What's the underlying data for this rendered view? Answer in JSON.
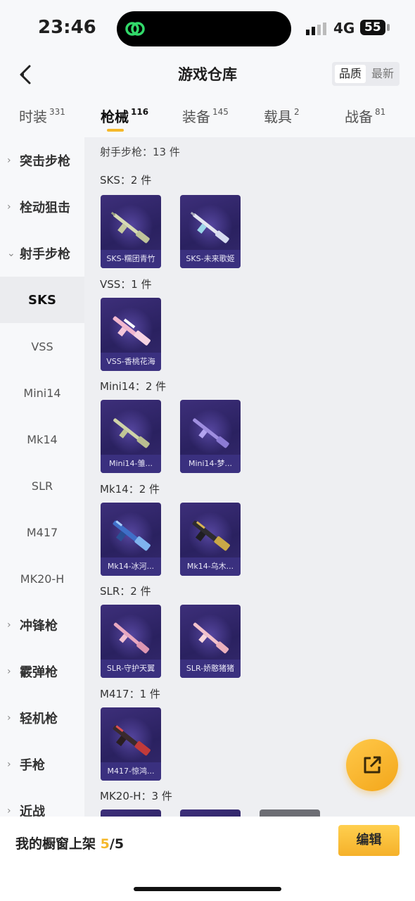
{
  "status": {
    "time": "23:46",
    "network": "4G",
    "battery": "55"
  },
  "header": {
    "title": "游戏仓库",
    "sort_quality": "品质",
    "sort_latest": "最新"
  },
  "tabs": [
    {
      "label": "时装",
      "count": "331"
    },
    {
      "label": "枪械",
      "count": "116"
    },
    {
      "label": "装备",
      "count": "145"
    },
    {
      "label": "载具",
      "count": "2"
    },
    {
      "label": "战备",
      "count": "81"
    }
  ],
  "sidebar": {
    "items": [
      {
        "label": "突击步枪"
      },
      {
        "label": "栓动狙击"
      },
      {
        "label": "射手步枪"
      },
      {
        "label": "SKS"
      },
      {
        "label": "VSS"
      },
      {
        "label": "Mini14"
      },
      {
        "label": "Mk14"
      },
      {
        "label": "SLR"
      },
      {
        "label": "M417"
      },
      {
        "label": "MK20-H"
      },
      {
        "label": "冲锋枪"
      },
      {
        "label": "霰弹枪"
      },
      {
        "label": "轻机枪"
      },
      {
        "label": "手枪"
      },
      {
        "label": "近战"
      }
    ]
  },
  "main": {
    "header": "射手步枪：13 件",
    "groups": [
      {
        "title": "SKS：2 件",
        "items": [
          "SKS-糯团青竹",
          "SKS-未来歌姬"
        ]
      },
      {
        "title": "VSS：1 件",
        "items": [
          "VSS-香桃花海"
        ]
      },
      {
        "title": "Mini14：2 件",
        "items": [
          "Mini14-雏...",
          "Mini14-梦..."
        ]
      },
      {
        "title": "Mk14：2 件",
        "items": [
          "Mk14-冰河...",
          "Mk14-乌木..."
        ]
      },
      {
        "title": "SLR：2 件",
        "items": [
          "SLR-守护天翼",
          "SLR-娇憨猪猪"
        ]
      },
      {
        "title": "M417：1 件",
        "items": [
          "M417-惊鸿..."
        ]
      },
      {
        "title": "MK20-H：3 件",
        "items": []
      }
    ]
  },
  "bottom": {
    "shelf_label": "我的橱窗上架",
    "shelf_count": "5",
    "shelf_total": "/5",
    "edit_label": "编辑"
  },
  "colors": {
    "accent": "#f5b82a",
    "card_bg": "#2f2468"
  }
}
